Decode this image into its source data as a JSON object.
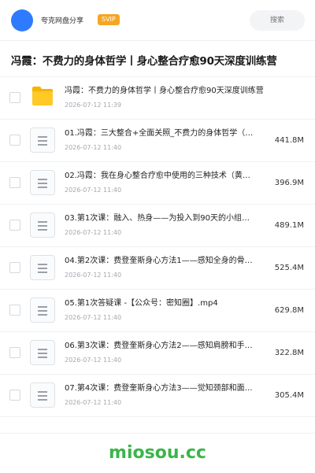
{
  "header": {
    "brand": "夸克网盘分享",
    "badge": "SVIP",
    "search_placeholder": "搜索",
    "accent_color": "#2f7bff",
    "badge_color": "#f5a623"
  },
  "title": "冯霞：不费力的身体哲学丨身心整合疗愈90天深度训练营",
  "files": [
    {
      "name": "冯霞：不费力的身体哲学丨身心整合疗愈90天深度训练营",
      "date": "2026-07-12 11:39",
      "size": "",
      "icon": "folder-icon"
    },
    {
      "name": "01.冯霞：三大整合+全面关照_不费力的身体哲学（…",
      "date": "2026-07-12 11:40",
      "size": "441.8M",
      "icon": "file-icon"
    },
    {
      "name": "02.冯霞：我在身心整合疗愈中使用的三种技术（黄…",
      "date": "2026-07-12 11:40",
      "size": "396.9M",
      "icon": "file-icon"
    },
    {
      "name": "03.第1次课：融入、热身——为投入到90天的小组…",
      "date": "2026-07-12 11:40",
      "size": "489.1M",
      "icon": "file-icon"
    },
    {
      "name": "04.第2次课：费登奎斯身心方法1——感知全身的骨…",
      "date": "2026-07-12 11:40",
      "size": "525.4M",
      "icon": "file-icon"
    },
    {
      "name": "05.第1次答疑课 -【公众号：密知圈】.mp4",
      "date": "2026-07-12 11:40",
      "size": "629.8M",
      "icon": "file-icon"
    },
    {
      "name": "06.第3次课：费登奎斯身心方法2——感知肩膀和手…",
      "date": "2026-07-12 11:40",
      "size": "322.8M",
      "icon": "file-icon"
    },
    {
      "name": "07.第4次课：费登奎斯身心方法3——觉知颈部和面…",
      "date": "2026-07-12 11:40",
      "size": "305.4M",
      "icon": "file-icon"
    }
  ],
  "watermark": "miosou.cc"
}
